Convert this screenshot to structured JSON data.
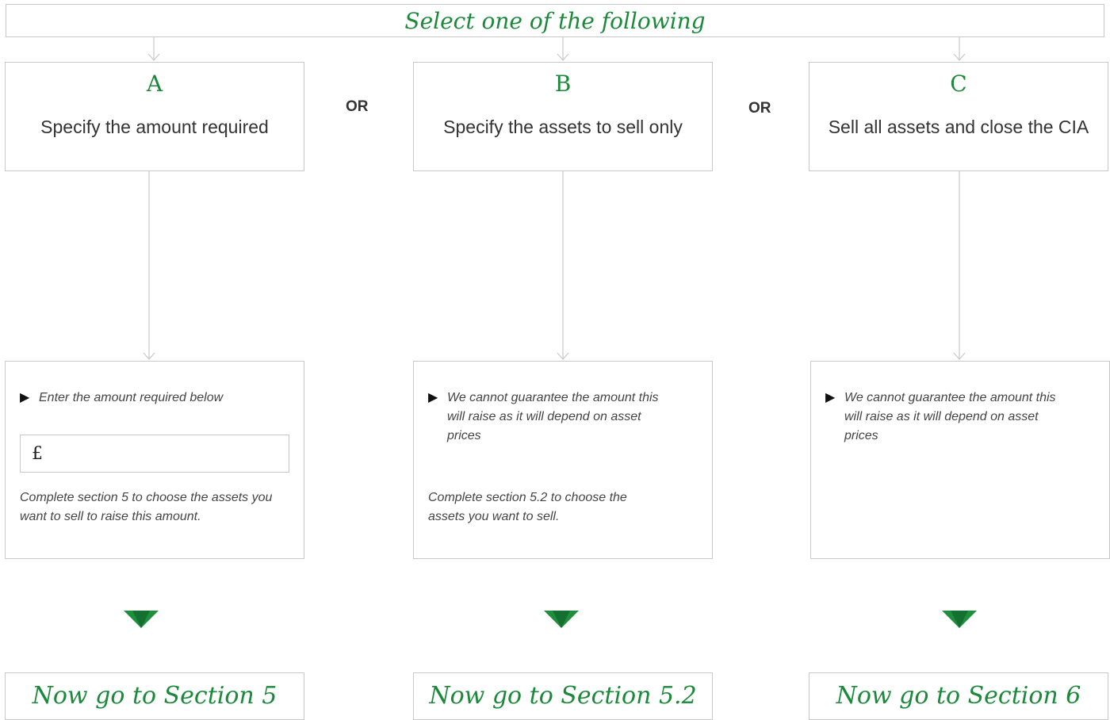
{
  "header": {
    "title": "Select one of the following"
  },
  "separator": "OR",
  "options": [
    {
      "letter": "A",
      "description": "Specify the amount required"
    },
    {
      "letter": "B",
      "description": "Specify the assets to sell only"
    },
    {
      "letter": "C",
      "description": "Sell all assets and close the CIA"
    }
  ],
  "info_a": {
    "bullet": "Enter the amount required below",
    "currency": "£",
    "amount_value": "",
    "note": "Complete section 5 to choose the assets you want to sell to raise this amount."
  },
  "info_b": {
    "bullet": "We cannot guarantee the amount this will raise as it will depend on asset prices",
    "note": "Complete section 5.2 to choose the assets you want to sell."
  },
  "info_c": {
    "bullet": "We cannot guarantee the amount this will raise as it will depend on asset prices"
  },
  "goto": [
    "Now go to Section 5",
    "Now go to Section 5.2",
    "Now go to Section 6"
  ],
  "colors": {
    "accent_green": "#1a8a3a",
    "marker_green": "#1f8f3e",
    "border": "#c8c8c8"
  },
  "icons": {
    "bullet": "right-pointing-triangle",
    "marker": "down-pointing-triangle"
  }
}
